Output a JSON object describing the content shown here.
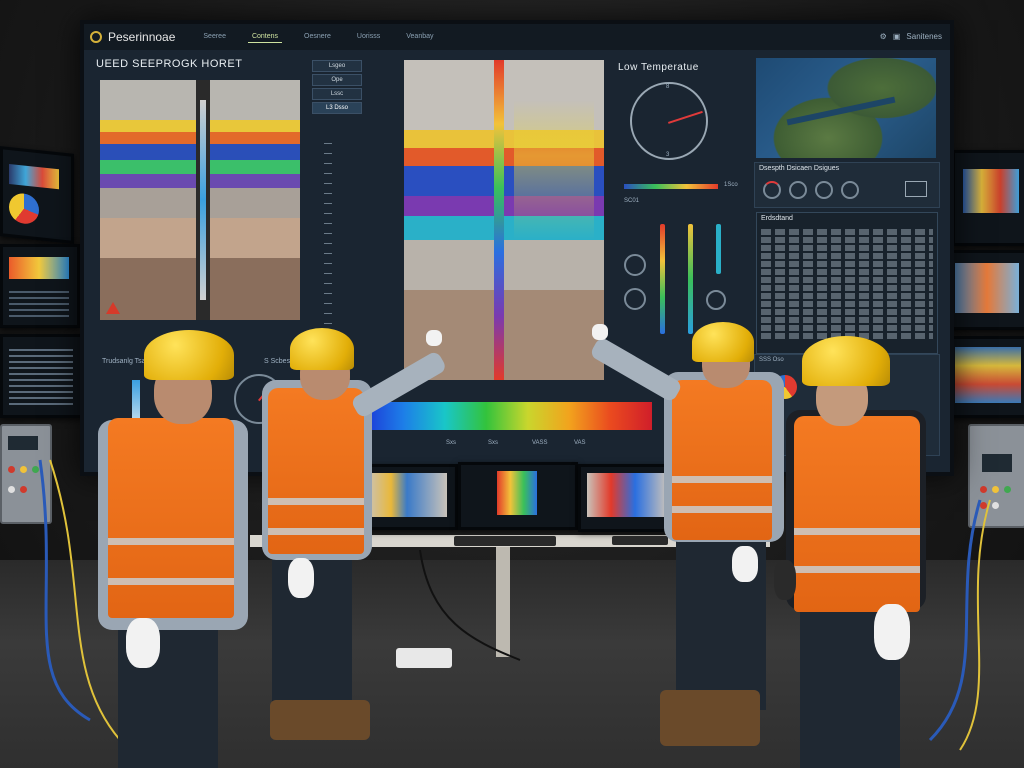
{
  "wall_display": {
    "brand": "Peserinnoae",
    "nav_tabs": [
      "Seeree",
      "Contens",
      "Oesnere",
      "Uorisss",
      "Veanbay"
    ],
    "active_tab": "Contens",
    "top_right_label": "Sanitenes",
    "left_panel_title": "UEED SEEPROGK HORET",
    "center_right_title": "Low Temperatue",
    "menu_items": [
      "Lsgeo",
      "Ope",
      "Lssc",
      "L3 Dsso"
    ],
    "menu_selected": "L3 Dsso",
    "right_section_title": "Dsespth Dsicaen Dsigues",
    "table_title": "Erdsdtand",
    "bottom_left_label": "Trudsanlg Tsas",
    "bottom_left_sub": "S Scbesdissle",
    "bottom_right_label": "SSS Oso",
    "center_bottom_labels": [
      "T",
      "T6",
      "T0B",
      "506",
      "CC6",
      "C0",
      "LCS"
    ],
    "spectrum_ticks": [
      "Sxs",
      "Sxs",
      "VASS",
      "VAS"
    ],
    "gauge_labels": [
      "8",
      "4",
      "3"
    ],
    "small_labels": [
      "1Sco",
      "SC01",
      "Wzo",
      "HSeS",
      "Tsas",
      "Osansacs"
    ]
  },
  "colors": {
    "vest": "#f47a22",
    "helmet": "#f2c416",
    "screen_bg": "#1a2531",
    "spectrum_blue": "#1d34d6",
    "spectrum_red": "#d01e2a"
  },
  "icons": [
    "warning-icon",
    "compass-gauge-icon",
    "map-icon",
    "settings-icon"
  ]
}
